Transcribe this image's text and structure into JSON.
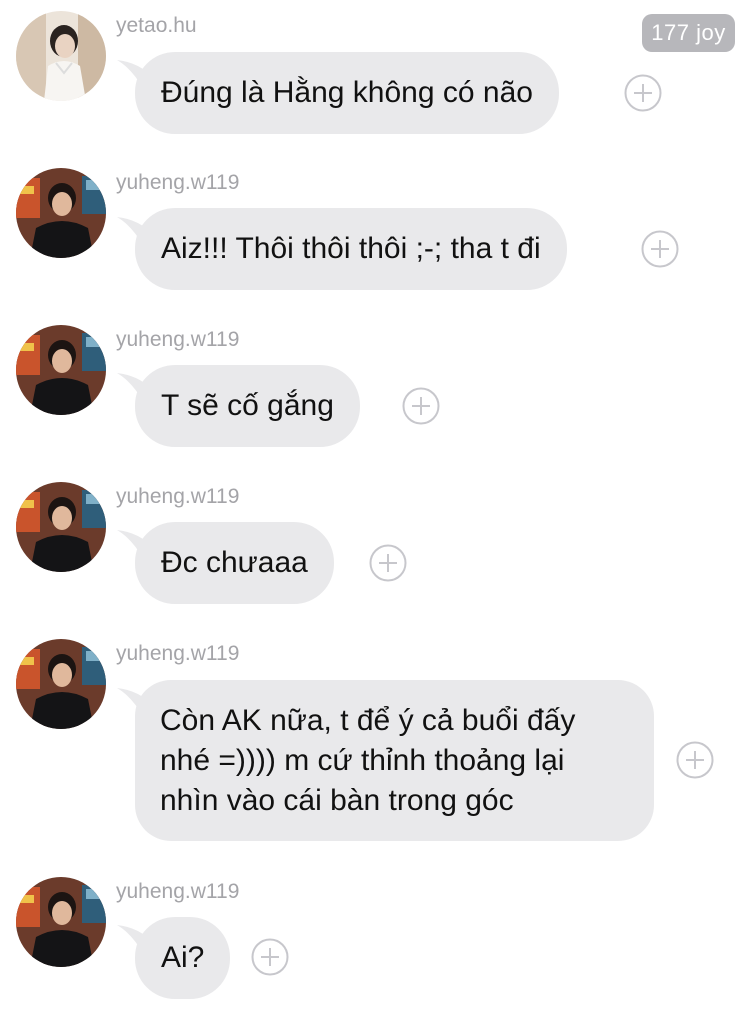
{
  "header": {
    "reaction_count": "177 joy"
  },
  "messages": [
    {
      "username": "yetao.hu",
      "text": "Đúng là Hằng không có não",
      "avatar": "avatar-yetao"
    },
    {
      "username": "yuheng.w119",
      "text": "Aiz!!! Thôi thôi thôi ;-; tha t đi",
      "avatar": "avatar-yuheng"
    },
    {
      "username": "yuheng.w119",
      "text": "T sẽ cố gắng",
      "avatar": "avatar-yuheng"
    },
    {
      "username": "yuheng.w119",
      "text": "Đc chưaaa",
      "avatar": "avatar-yuheng"
    },
    {
      "username": "yuheng.w119",
      "text": "Còn AK nữa, t để ý cả buổi đấy nhé =)))) m cứ thỉnh thoảng lại nhìn vào cái bàn trong góc",
      "avatar": "avatar-yuheng"
    },
    {
      "username": "yuheng.w119",
      "text": "Ai?",
      "avatar": "avatar-yuheng"
    }
  ],
  "colors": {
    "bubble": "#e9e9eb",
    "username": "#a4a4a8",
    "badge": "#b7b7bb",
    "add_icon": "#c7c7cc"
  },
  "icons": {
    "add_reaction": "plus-circle-icon"
  }
}
